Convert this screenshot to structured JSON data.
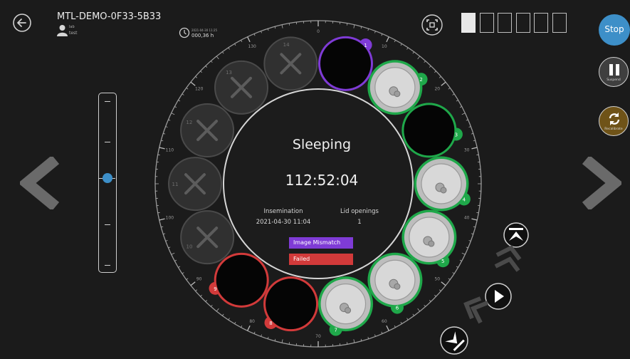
{
  "header": {
    "title": "MTL-DEMO-0F33-5B33",
    "user_role": "lab",
    "user_name": "test",
    "run_date": "2021-04-30 11:25",
    "run_hours": "000,36 h"
  },
  "dish_selector": {
    "count": 6,
    "active_index": 0
  },
  "controls": {
    "stop_label": "Stop",
    "suspend_label": "Suspend",
    "recalibrate_label": "Recalibrate"
  },
  "zoom": {
    "level_fraction": 0.5
  },
  "center": {
    "state": "Sleeping",
    "elapsed": "112:52:04",
    "insemination_label": "Insemination",
    "insemination_value": "2021-04-30 11:04",
    "lid_label": "Lid openings",
    "lid_value": "1"
  },
  "legend": {
    "mismatch_label": "Image Mismatch",
    "failed_label": "Failed"
  },
  "colors": {
    "accent_blue": "#3d8fc8",
    "ok_green": "#1fa84a",
    "mismatch_purple": "#7f3bd6",
    "failed_red": "#d23a3a",
    "recalibrate_gold": "#6f5318"
  },
  "dial_labels": [
    "0",
    "10",
    "20",
    "30",
    "40",
    "50",
    "60",
    "70",
    "80",
    "90",
    "100",
    "110",
    "120",
    "130"
  ],
  "wells": [
    {
      "number": "1",
      "status": "mismatch",
      "content": "dark"
    },
    {
      "number": "2",
      "status": "ok",
      "content": "embryo"
    },
    {
      "number": "3",
      "status": "ok",
      "content": "dark"
    },
    {
      "number": "4",
      "status": "ok",
      "content": "embryo"
    },
    {
      "number": "5",
      "status": "ok",
      "content": "embryo"
    },
    {
      "number": "6",
      "status": "ok",
      "content": "embryo"
    },
    {
      "number": "7",
      "status": "ok",
      "content": "embryo"
    },
    {
      "number": "8",
      "status": "failed",
      "content": "dark"
    },
    {
      "number": "9",
      "status": "failed",
      "content": "dark"
    },
    {
      "number": "10",
      "status": "disabled",
      "content": "empty"
    },
    {
      "number": "11",
      "status": "disabled",
      "content": "empty"
    },
    {
      "number": "12",
      "status": "disabled",
      "content": "empty"
    },
    {
      "number": "13",
      "status": "disabled",
      "content": "empty"
    },
    {
      "number": "14",
      "status": "disabled",
      "content": "empty"
    }
  ]
}
